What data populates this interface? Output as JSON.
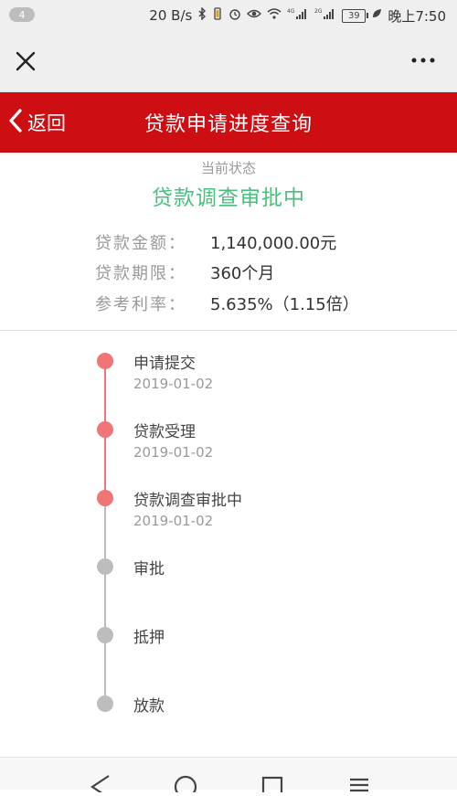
{
  "status_bar": {
    "notification_count": "4",
    "net_speed": "20 B/s",
    "signal_1_label": "4G",
    "signal_2_label": "2G",
    "battery_level": "39",
    "time": "晚上7:50"
  },
  "webview": {
    "close_icon": "close-icon",
    "more_icon": "more-icon"
  },
  "header": {
    "back_label": "返回",
    "title": "贷款申请进度查询",
    "color": "#cd0f14"
  },
  "status": {
    "label": "当前状态",
    "value": "贷款调查审批中",
    "value_color": "#4bbf7f"
  },
  "details": [
    {
      "label": "贷款金额：",
      "value": "1,140,000.00元"
    },
    {
      "label": "贷款期限：",
      "value": "360个月"
    },
    {
      "label": "参考利率：",
      "value": "5.635%（1.15倍）"
    }
  ],
  "timeline": [
    {
      "title": "申请提交",
      "date": "2019-01-02",
      "done": true
    },
    {
      "title": "贷款受理",
      "date": "2019-01-02",
      "done": true
    },
    {
      "title": "贷款调查审批中",
      "date": "2019-01-02",
      "done": true
    },
    {
      "title": "审批",
      "date": "",
      "done": false
    },
    {
      "title": "抵押",
      "date": "",
      "done": false
    },
    {
      "title": "放款",
      "date": "",
      "done": false
    }
  ],
  "colors": {
    "timeline_done": "#f07576",
    "timeline_pending": "#bdbdbd"
  },
  "nav": {
    "back_icon": "triangle-back-icon",
    "home_icon": "circle-home-icon",
    "recents_icon": "square-recents-icon",
    "menu_icon": "menu-icon"
  }
}
